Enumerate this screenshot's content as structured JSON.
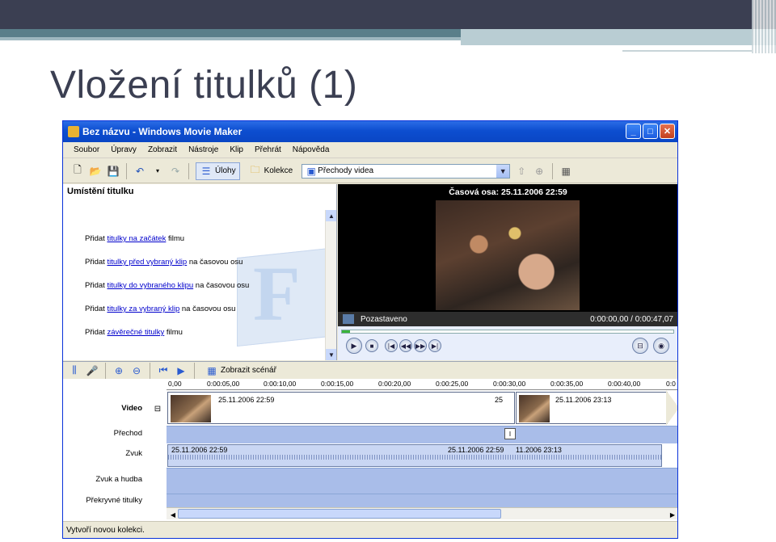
{
  "slide": {
    "title": "Vložení titulků (1)"
  },
  "window": {
    "title": "Bez názvu - Windows Movie Maker",
    "controls": {
      "minimize": "_",
      "maximize": "□",
      "close": "✕"
    }
  },
  "menu": [
    "Soubor",
    "Úpravy",
    "Zobrazit",
    "Nástroje",
    "Klip",
    "Přehrát",
    "Nápověda"
  ],
  "toolbar": {
    "tasks_label": "Úlohy",
    "collections_label": "Kolekce",
    "dropdown_value": "Přechody videa"
  },
  "taskpane": {
    "heading": "Umístění titulku",
    "items": [
      {
        "pre": "Přidat ",
        "link": "titulky na začátek",
        "post": " filmu"
      },
      {
        "pre": "Přidat ",
        "link": "titulky před vybraný klip",
        "post": " na časovou osu"
      },
      {
        "pre": "Přidat ",
        "link": "titulky do vybraného klipu",
        "post": " na časovou osu"
      },
      {
        "pre": "Přidat ",
        "link": "titulky za vybraný klip",
        "post": " na časovou osu"
      },
      {
        "pre": "Přidat ",
        "link": "závěrečné titulky",
        "post": " filmu"
      }
    ]
  },
  "preview": {
    "title": "Časová osa: 25.11.2006 22:59",
    "status": "Pozastaveno",
    "time": "0:00:00,00 / 0:00:47,07"
  },
  "timeline": {
    "show_storyboard": "Zobrazit scénář",
    "ruler": [
      "0,00",
      "0:00:05,00",
      "0:00:10,00",
      "0:00:15,00",
      "0:00:20,00",
      "0:00:25,00",
      "0:00:30,00",
      "0:00:35,00",
      "0:00:40,00",
      "0:0"
    ],
    "tracks": [
      "Video",
      "Přechod",
      "Zvuk",
      "Zvuk a hudba",
      "Překryvné titulky"
    ],
    "video_clips": [
      "25.11.2006 22:59",
      "25.11.2006 23:13"
    ],
    "video_clip1_tail": "25",
    "audio_clips": [
      "25.11.2006 22:59",
      "25.11.2006 22:59",
      "11.2006 23:13"
    ]
  },
  "statusbar": {
    "text": "Vytvoří novou kolekci."
  }
}
